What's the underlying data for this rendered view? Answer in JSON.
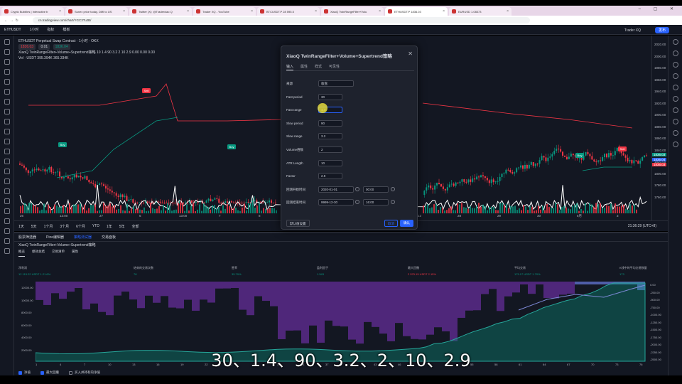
{
  "browser": {
    "tabs": [
      {
        "label": "Crypto Bubbles | Interactive b"
      },
      {
        "label": "Sunex price today, DMI to US"
      },
      {
        "label": "Twitter (X): @Traderxiao Q"
      },
      {
        "label": "Trader XQ - YouTube"
      },
      {
        "label": "BTCUSDT.P 28 595.5"
      },
      {
        "label": "XiaoQ TwinRangeFilter+Volu"
      },
      {
        "label": "ETHUSDT.P 1836.03"
      },
      {
        "label": "EURUSD 1.08373"
      }
    ],
    "url": "cn.tradingview.com/chart/YGC3TuJB/"
  },
  "toolbar": {
    "symbol": "ETHUSDT",
    "interval": "1小时",
    "items": [
      "指标",
      "模板"
    ],
    "user": "Trader XQ",
    "publish": "发布"
  },
  "chart": {
    "title": "ETHUSDT Perpetual Swap Contract · 1小时 · OKX",
    "price_tags": [
      "1836.03",
      "0.01",
      "1836.04"
    ],
    "indicator_line": "XiaoQ TwinRangeFilter+Volume+Supertrend策略 10 1.4 90 3.2 2 10 2.9 0.00 0.00 0.00",
    "vol_line": "Vol · USDT 395.394K 365.334K",
    "signal_labels": [
      {
        "text": "Buy",
        "color": "#089981"
      },
      {
        "text": "Buy",
        "color": "#089981"
      },
      {
        "text": "Sell",
        "color": "#f23645"
      },
      {
        "text": "Buy",
        "color": "#089981"
      },
      {
        "text": "Sell",
        "color": "#f23645"
      }
    ],
    "price_ticks": [
      "2020.00",
      "2000.00",
      "1980.00",
      "1960.00",
      "1940.00",
      "1920.00",
      "1900.00",
      "1880.00",
      "1860.00",
      "1840.00",
      "1820.00",
      "1800.00",
      "1780.00",
      "1760.00"
    ],
    "price_badges": [
      {
        "text": "1836.03",
        "color": "#089981"
      },
      {
        "text": "1836.04",
        "color": "#2962ff"
      },
      {
        "text": "1836.03",
        "color": "#f23645"
      }
    ],
    "time_ticks": [
      "26",
      "13:00",
      "27",
      "5",
      "13:00",
      "7",
      "8",
      "13:00",
      "10",
      "11",
      "12",
      "28",
      "29",
      "30",
      "5月",
      "3"
    ],
    "ranges": [
      "1天",
      "5天",
      "1个月",
      "3个月",
      "6个月",
      "YTD",
      "1年",
      "5年",
      "全部"
    ],
    "timezone": "21:36:29 (UTC+8)",
    "bottom_right": [
      "%",
      "log",
      "自动"
    ]
  },
  "tester": {
    "tabs": [
      "股票筛选器",
      "Pine编辑器",
      "策略测试器",
      "交易面板"
    ],
    "active_tab": 2,
    "strategy_name": "XiaoQ TwinRangeFilter+Volume+Supertrend策略",
    "subtabs": [
      "概览",
      "绩效总结",
      "交易清单",
      "属性"
    ],
    "metrics": [
      {
        "label": "净利润",
        "value": "12 115.22 USDT  1.21.6%",
        "neg": false
      },
      {
        "label": "结束的交易次数",
        "value": "78",
        "neg": false
      },
      {
        "label": "胜率",
        "value": "35.79%",
        "neg": false
      },
      {
        "label": "盈利因子",
        "value": "1.543",
        "neg": false
      },
      {
        "label": "最大回撤",
        "value": "2 575.15 USDT  2.15%",
        "neg": true
      },
      {
        "label": "平均交易",
        "value": "175.17 USDT  1.70%",
        "neg": false
      },
      {
        "label": "K线中的平均交易数量",
        "value": "173",
        "neg": false
      }
    ],
    "y_ticks": [
      "12000.00",
      "10000.00",
      "8000.00",
      "6000.00",
      "4000.00",
      "2000.00"
    ],
    "y2_ticks": [
      "0.00",
      "-250.00",
      "-500.00",
      "-750.00",
      "-1000.00",
      "-1250.00",
      "-1500.00",
      "-1750.00",
      "-2000.00",
      "-2250.00",
      "-2500.00"
    ],
    "x_ticks": [
      "1",
      "4",
      "7",
      "10",
      "13",
      "16",
      "19",
      "22",
      "25",
      "28",
      "31",
      "34",
      "37",
      "40",
      "43",
      "46",
      "49",
      "52",
      "55",
      "58",
      "61",
      "64",
      "67",
      "70",
      "73",
      "76"
    ],
    "legend": [
      "净值",
      "最大回撤",
      "买入并持有的净值"
    ]
  },
  "dialog": {
    "title": "XiaoQ TwinRangeFilter+Volume+Supertrend策略",
    "tabs": [
      "输入",
      "属性",
      "样式",
      "可见性"
    ],
    "fields": [
      {
        "label": "来源",
        "value": "收盘"
      },
      {
        "label": "Fast period",
        "value": "30"
      },
      {
        "label": "Fast range",
        "value": "1.4"
      },
      {
        "label": "Slow period",
        "value": "90"
      },
      {
        "label": "Slow range",
        "value": "3.2"
      },
      {
        "label": "Volume倍数",
        "value": "2"
      },
      {
        "label": "ATR Length",
        "value": "10"
      },
      {
        "label": "Factor",
        "value": "2.9"
      },
      {
        "label": "回测开始时间",
        "value": "2020-01-01",
        "value2": "00:00"
      },
      {
        "label": "回测结束时间",
        "value": "9999-12-30",
        "value2": "16:00"
      }
    ],
    "default_label": "默认值设置",
    "cancel_label": "取消",
    "ok_label": "确认"
  },
  "subtitle": "30、1.4、90、3.2、2、10、2.9"
}
